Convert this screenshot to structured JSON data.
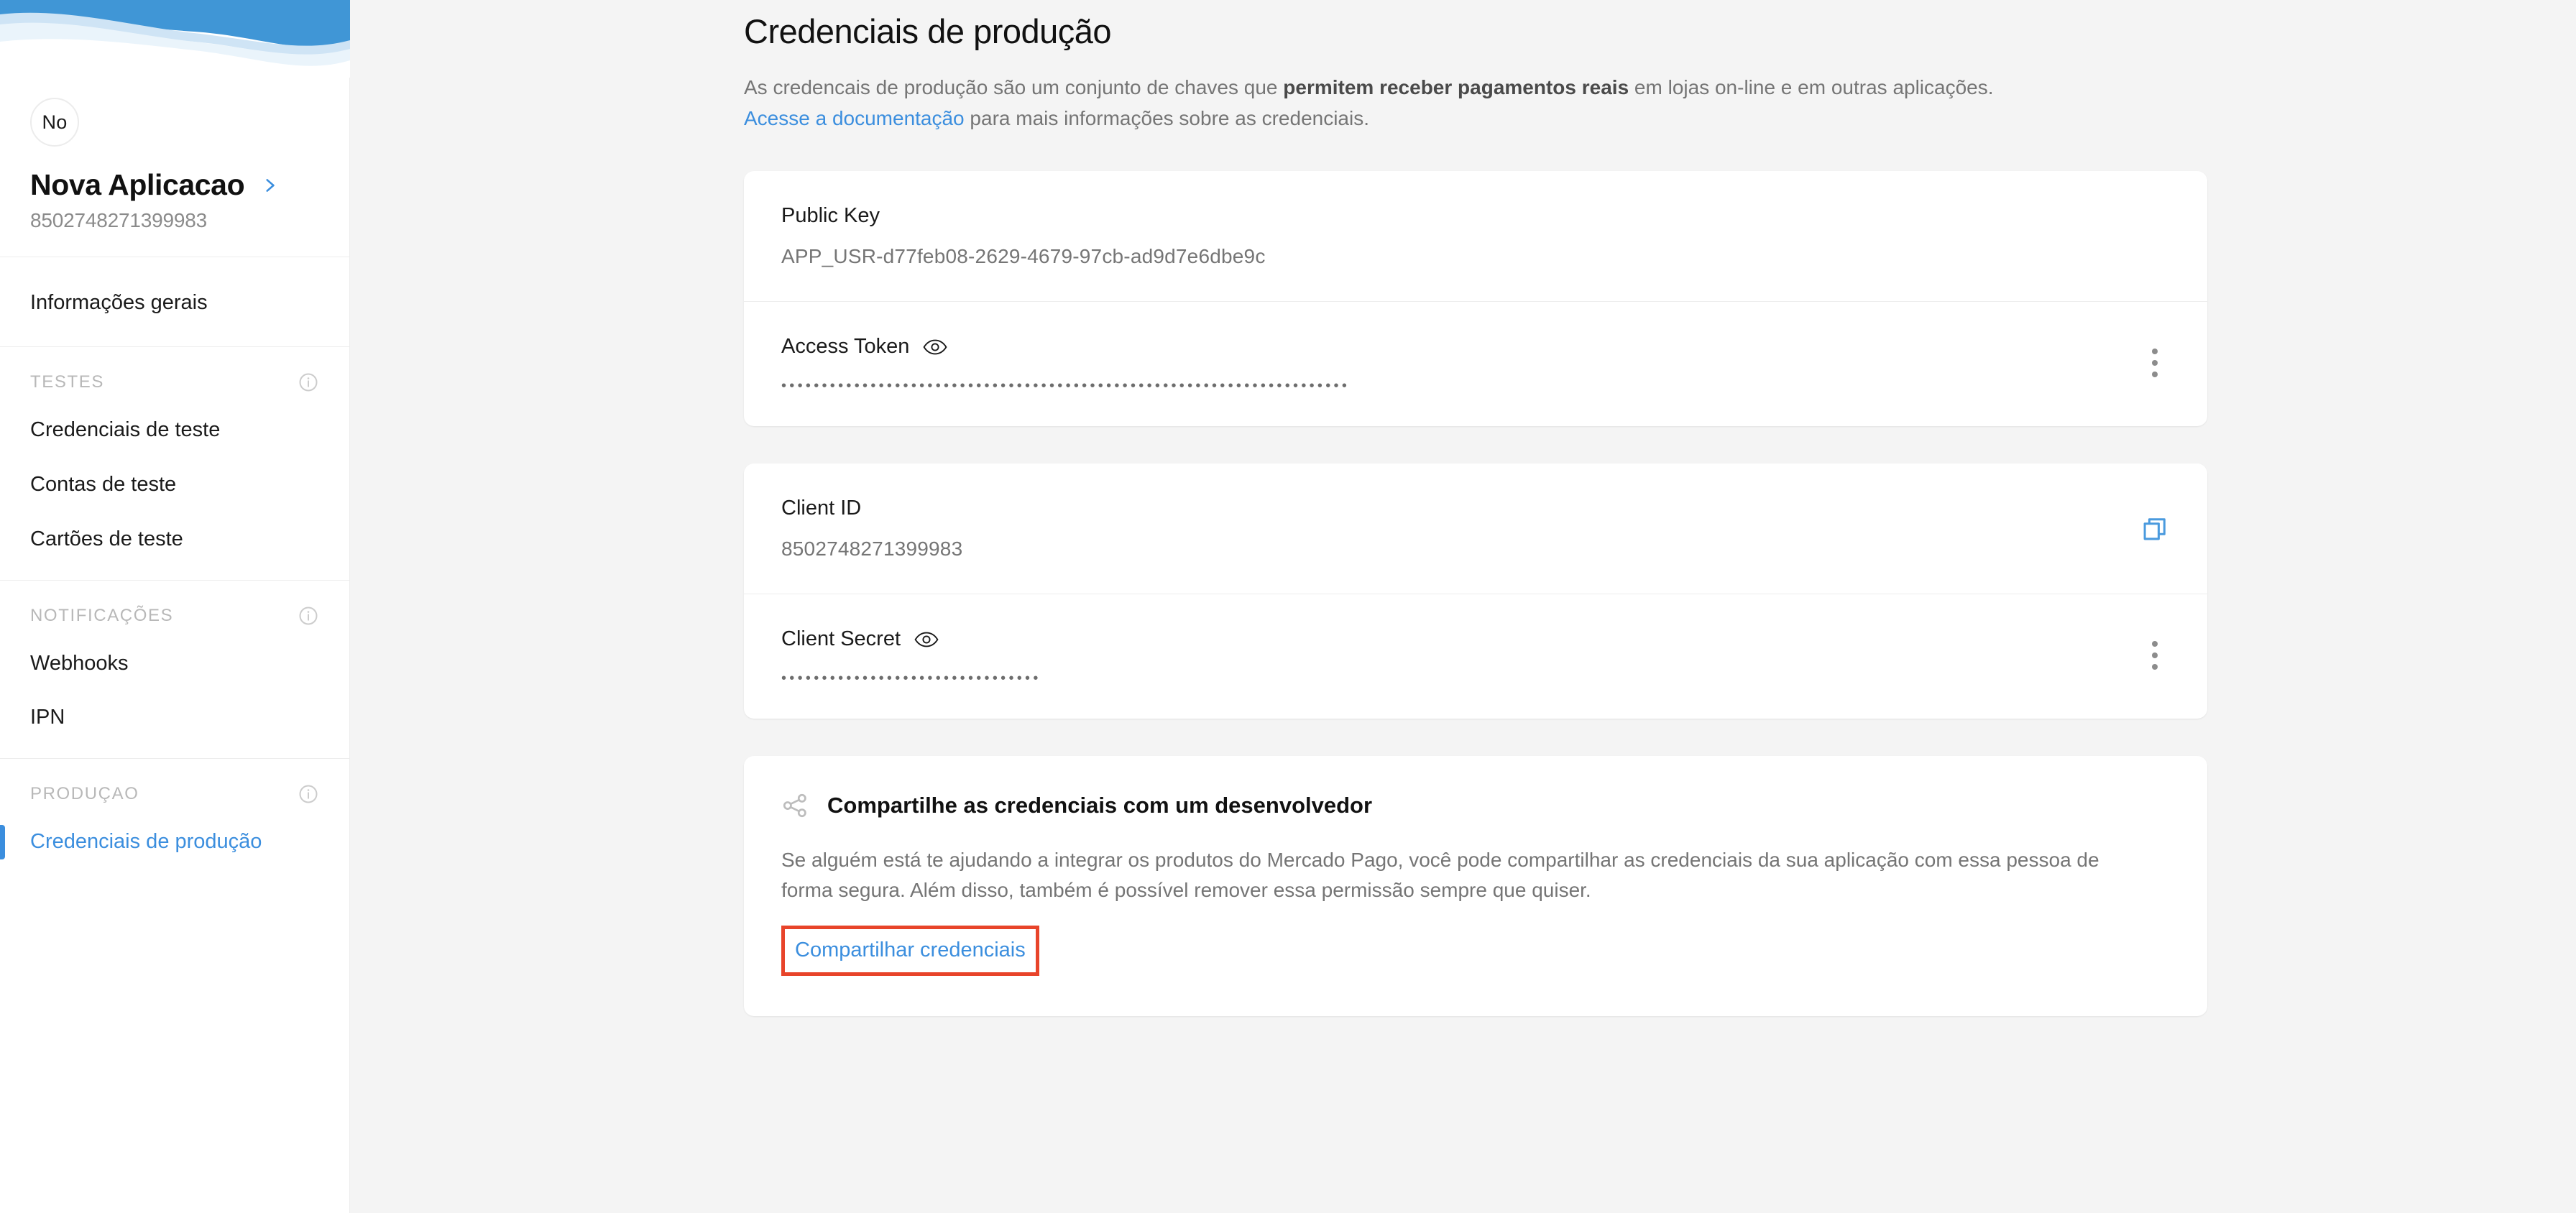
{
  "colors": {
    "brand_blue": "#3b8ede",
    "wave_blue": "#4096d6",
    "wave_light": "#d8e9f7",
    "wave_lightest": "#eaf4fb",
    "highlight_red": "#e8442a",
    "text_dark": "#1a1a1a",
    "text_muted": "#757575",
    "page_bg": "#f4f4f4"
  },
  "sidebar": {
    "avatar_initials": "No",
    "app_name": "Nova Aplicacao",
    "app_id": "8502748271399983",
    "chevron_icon": "chevron-right-icon",
    "top_item": {
      "label": "Informações gerais"
    },
    "groups": [
      {
        "title": "TESTES",
        "info_icon": "info-icon",
        "items": [
          {
            "label": "Credenciais de teste",
            "active": false
          },
          {
            "label": "Contas de teste",
            "active": false
          },
          {
            "label": "Cartões de teste",
            "active": false
          }
        ]
      },
      {
        "title": "NOTIFICAÇÕES",
        "info_icon": "info-icon",
        "items": [
          {
            "label": "Webhooks",
            "active": false
          },
          {
            "label": "IPN",
            "active": false
          }
        ]
      },
      {
        "title": "PRODUÇAO",
        "info_icon": "info-icon",
        "items": [
          {
            "label": "Credenciais de produção",
            "active": true
          }
        ]
      }
    ]
  },
  "main": {
    "title": "Credenciais de produção",
    "desc_part1": "As credencais de produção são um conjunto de chaves que ",
    "desc_bold": "permitem receber pagamentos reais",
    "desc_part2": " em lojas on-line e em outras aplicações.",
    "doc_link": "Acesse a documentação",
    "desc_part3": " para mais informações sobre as credenciais.",
    "credentials_card_1": [
      {
        "label": "Public Key",
        "value": "APP_USR-d77feb08-2629-4679-97cb-ad9d7e6dbe9c",
        "masked": false,
        "action_icon": "none"
      },
      {
        "label": "Access Token",
        "value": "••••••••••••••••••••••••••••••••••••••••••••••••••••••••••••••••••••••",
        "masked": true,
        "toggle_icon": "eye-icon",
        "action_icon": "kebab-menu-icon"
      }
    ],
    "credentials_card_2": [
      {
        "label": "Client ID",
        "value": "8502748271399983",
        "masked": false,
        "action_icon": "copy-icon"
      },
      {
        "label": "Client Secret",
        "value": "••••••••••••••••••••••••••••••••",
        "masked": true,
        "toggle_icon": "eye-icon",
        "action_icon": "kebab-menu-icon"
      }
    ],
    "share_card": {
      "icon": "share-icon",
      "title": "Compartilhe as credenciais com um desenvolvedor",
      "text": "Se alguém está te ajudando a integrar os produtos do Mercado Pago, você pode compartilhar as credenciais da sua aplicação com essa pessoa de forma segura. Além disso, também é possível remover essa permissão sempre que quiser.",
      "link": "Compartilhar credenciais",
      "link_highlighted": true
    }
  }
}
